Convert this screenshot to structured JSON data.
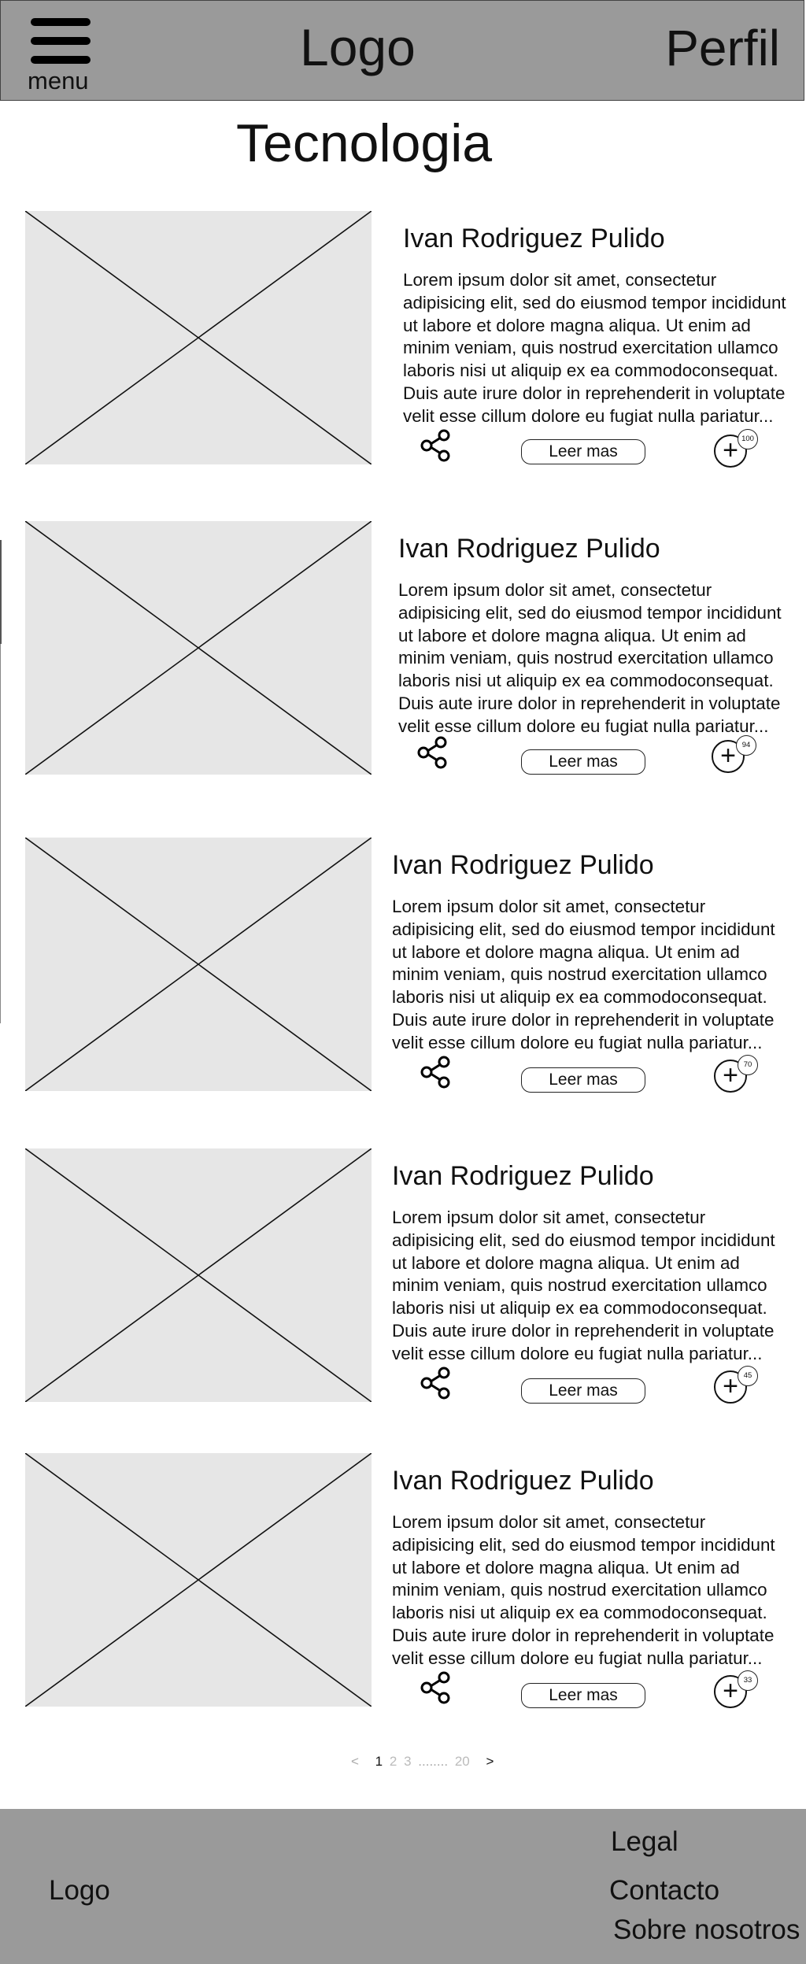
{
  "header": {
    "menu_label": "menu",
    "logo": "Logo",
    "profile": "Perfil"
  },
  "section_title": "Tecnologia",
  "articles": [
    {
      "author": "Ivan Rodriguez Pulido",
      "excerpt": "Lorem ipsum dolor sit amet, consectetur adipisicing elit, sed do eiusmod tempor incididunt ut labore et dolore magna aliqua. Ut enim ad minim veniam, quis nostrud exercitation ullamco laboris nisi ut aliquip ex ea commodoconsequat. Duis aute irure dolor in reprehenderit in voluptate velit esse cillum dolore eu fugiat nulla pariatur...",
      "read_more": "Leer mas",
      "plus_symbol": "+",
      "count": "100"
    },
    {
      "author": "Ivan Rodriguez Pulido",
      "excerpt": "Lorem ipsum dolor sit amet, consectetur adipisicing elit, sed do eiusmod tempor incididunt ut labore et dolore magna aliqua. Ut enim ad minim veniam, quis nostrud exercitation ullamco laboris nisi ut aliquip ex ea commodoconsequat. Duis aute irure dolor in reprehenderit in voluptate velit esse cillum dolore eu fugiat nulla pariatur...",
      "read_more": "Leer mas",
      "plus_symbol": "+",
      "count": "94"
    },
    {
      "author": "Ivan Rodriguez Pulido",
      "excerpt": "Lorem ipsum dolor sit amet, consectetur adipisicing elit, sed do eiusmod tempor incididunt ut labore et dolore magna aliqua. Ut enim ad minim veniam, quis nostrud exercitation ullamco laboris nisi ut aliquip ex ea commodoconsequat. Duis aute irure dolor in reprehenderit in voluptate velit esse cillum dolore eu fugiat nulla pariatur...",
      "read_more": "Leer mas",
      "plus_symbol": "+",
      "count": "70"
    },
    {
      "author": "Ivan Rodriguez Pulido",
      "excerpt": "Lorem ipsum dolor sit amet, consectetur adipisicing elit, sed do eiusmod tempor incididunt ut labore et dolore magna aliqua. Ut enim ad minim veniam, quis nostrud exercitation ullamco laboris nisi ut aliquip ex ea commodoconsequat. Duis aute irure dolor in reprehenderit in voluptate velit esse cillum dolore eu fugiat nulla pariatur...",
      "read_more": "Leer mas",
      "plus_symbol": "+",
      "count": "45"
    },
    {
      "author": "Ivan Rodriguez Pulido",
      "excerpt": "Lorem ipsum dolor sit amet, consectetur adipisicing elit, sed do eiusmod tempor incididunt ut labore et dolore magna aliqua. Ut enim ad minim veniam, quis nostrud exercitation ullamco laboris nisi ut aliquip ex ea commodoconsequat. Duis aute irure dolor in reprehenderit in voluptate velit esse cillum dolore eu fugiat nulla pariatur...",
      "read_more": "Leer mas",
      "plus_symbol": "+",
      "count": "33"
    }
  ],
  "pagination": {
    "prev": "<",
    "current": "1",
    "page_2": "2",
    "page_3": "3",
    "ellipsis": "........",
    "last": "20",
    "next": ">"
  },
  "footer": {
    "logo": "Logo",
    "links": [
      "Legal",
      "Contacto",
      "Sobre nosotros"
    ]
  },
  "icons": {
    "menu": "hamburger-icon",
    "share": "share-icon",
    "add": "plus-icon",
    "placeholder": "image-placeholder"
  },
  "colors": {
    "bars": "#9a9a9a",
    "placeholder_fill": "#e6e6e6"
  }
}
